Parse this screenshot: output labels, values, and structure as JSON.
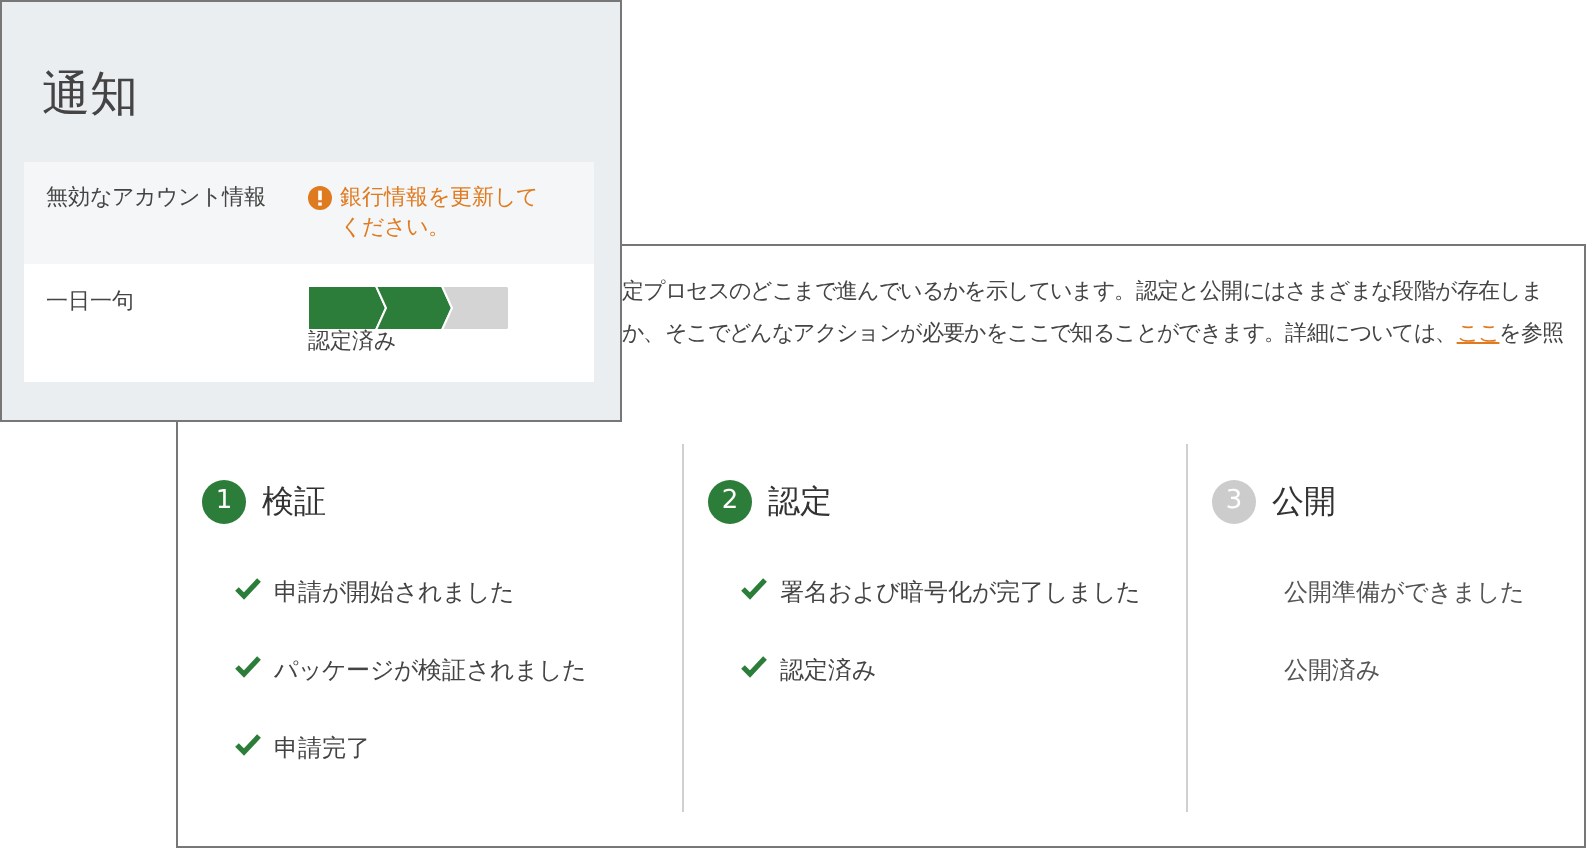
{
  "notification_popup": {
    "title": "通知",
    "rows": [
      {
        "kind": "alert",
        "label": "無効なアカウント情報",
        "message": "銀行情報を更新してください。"
      },
      {
        "kind": "progress",
        "label": "一日一句",
        "steps": [
          {
            "complete": true
          },
          {
            "complete": true
          },
          {
            "complete": false
          }
        ],
        "caption": "認定済み"
      }
    ]
  },
  "description": {
    "line_1": "定プロセスのどこまで進んでいるかを示しています。認定と公開にはさまざまな段階が存在しま",
    "line_2": {
      "before": "か、そこでどんなアクションが必要かをここで知ることができます。詳細については、",
      "link": "ここ",
      "after": "を参照"
    }
  },
  "stages": [
    {
      "number": "1",
      "title": "検証",
      "active": true,
      "items": [
        {
          "text": "申請が開始されました",
          "done": true
        },
        {
          "text": "パッケージが検証されました",
          "done": true
        },
        {
          "text": "申請完了",
          "done": true
        }
      ]
    },
    {
      "number": "2",
      "title": "認定",
      "active": true,
      "items": [
        {
          "text": "署名および暗号化が完了しました",
          "done": true
        },
        {
          "text": "認定済み",
          "done": true
        }
      ]
    },
    {
      "number": "3",
      "title": "公開",
      "active": false,
      "items": [
        {
          "text": "公開準備ができました",
          "done": false
        },
        {
          "text": "公開済み",
          "done": false
        }
      ]
    }
  ]
}
